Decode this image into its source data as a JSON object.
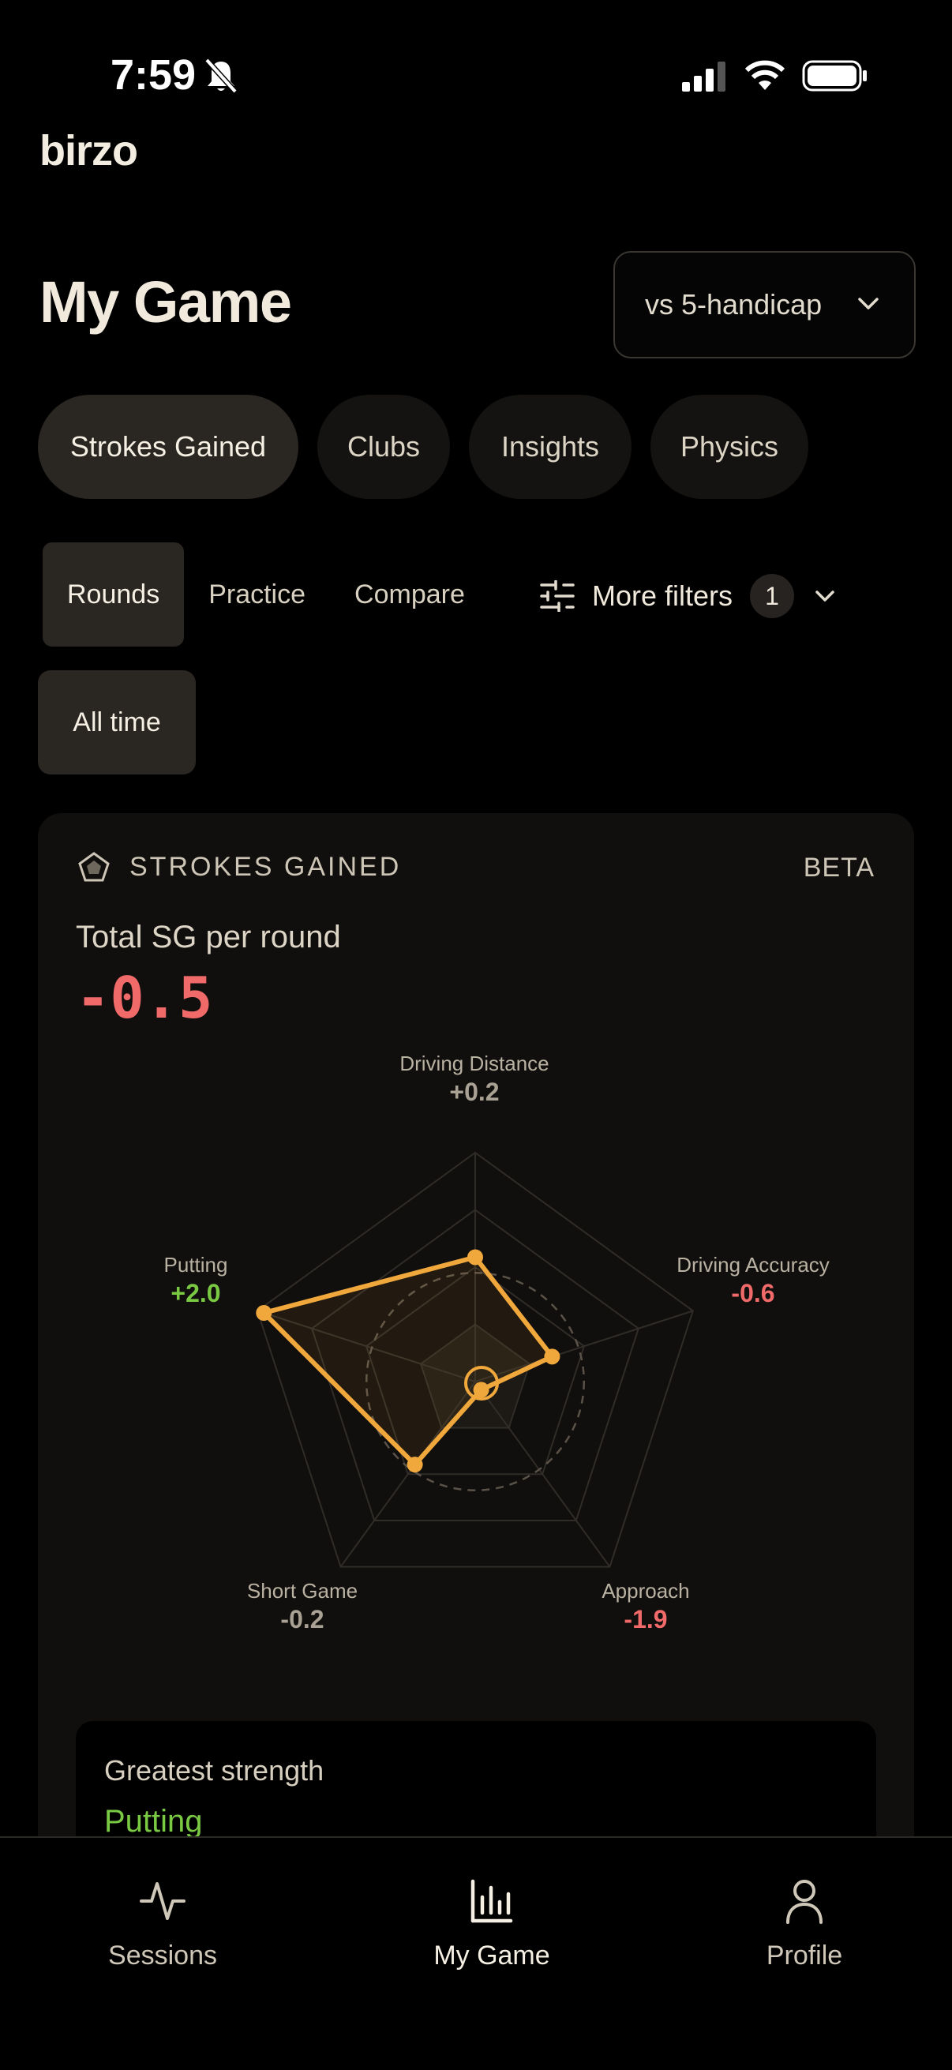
{
  "status_bar": {
    "time": "7:59"
  },
  "app": {
    "brand": "birzo"
  },
  "header": {
    "title": "My Game",
    "comparison_select": "vs 5-handicap"
  },
  "main_tabs": [
    {
      "label": "Strokes Gained",
      "active": true
    },
    {
      "label": "Clubs",
      "active": false
    },
    {
      "label": "Insights",
      "active": false
    },
    {
      "label": "Physics",
      "active": false
    }
  ],
  "sub_tabs": [
    {
      "label": "Rounds",
      "active": true
    },
    {
      "label": "Practice",
      "active": false
    },
    {
      "label": "Compare",
      "active": false
    }
  ],
  "filters": {
    "label": "More filters",
    "count": "1",
    "time_range": "All time"
  },
  "card": {
    "title": "STROKES GAINED",
    "badge": "BETA",
    "metric_label": "Total SG per round",
    "metric_value": "-0.5",
    "greatest_strength_label": "Greatest strength",
    "greatest_strength_value": "Putting"
  },
  "chart_data": {
    "type": "radar",
    "categories": [
      "Driving Distance",
      "Driving Accuracy",
      "Approach",
      "Short Game",
      "Putting"
    ],
    "values": [
      0.2,
      -0.6,
      -1.9,
      -0.2,
      2.0
    ],
    "value_labels": [
      "+0.2",
      "-0.6",
      "-1.9",
      "-0.2",
      "+2.0"
    ],
    "range": [
      -2,
      2
    ]
  },
  "colors": {
    "positive": "#7ac943",
    "negative": "#f06a6a",
    "neutral": "#a9a193",
    "accent": "#f0a83c"
  },
  "bottom_nav": [
    {
      "label": "Sessions",
      "icon": "activity-icon",
      "active": false
    },
    {
      "label": "My Game",
      "icon": "bar-chart-icon",
      "active": true
    },
    {
      "label": "Profile",
      "icon": "person-icon",
      "active": false
    }
  ]
}
